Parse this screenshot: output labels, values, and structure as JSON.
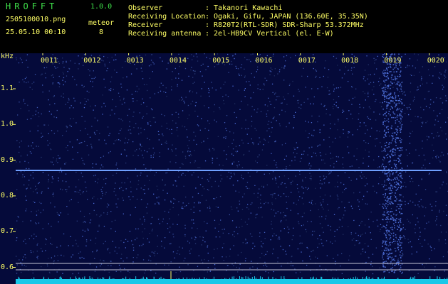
{
  "app": {
    "logo": "HROFFT",
    "version": "1.0.0"
  },
  "file": {
    "name": "2505100010.png",
    "timestamp": "25.05.10 00:10"
  },
  "meteor": {
    "label": "meteor",
    "count": "8"
  },
  "info": {
    "observer_label": "Observer",
    "observer": ": Takanori Kawachi",
    "location_label": "Receiving Location",
    "location": ": Ogaki, Gifu, JAPAN (136.60E, 35.35N)",
    "receiver_label": "Receiver",
    "receiver": ": R820T2(RTL-SDR) SDR-Sharp 53.372MHz",
    "antenna_label": "Receiving antenna",
    "antenna": ": 2el-HB9CV Vertical (el. E-W)"
  },
  "axis": {
    "unit": "kHz",
    "time_ticks": [
      "0011",
      "0012",
      "0013",
      "0014",
      "0015",
      "0016",
      "0017",
      "0018",
      "0019",
      "0020"
    ],
    "freq_ticks": [
      "1.1",
      "1.0",
      "0.9",
      "0.8",
      "0.7",
      "0.6"
    ]
  },
  "colors": {
    "header_green": "#3fe04a",
    "label_yellow": "#ffff66",
    "background": "#050a3a",
    "signal": "#6fa0ff"
  }
}
